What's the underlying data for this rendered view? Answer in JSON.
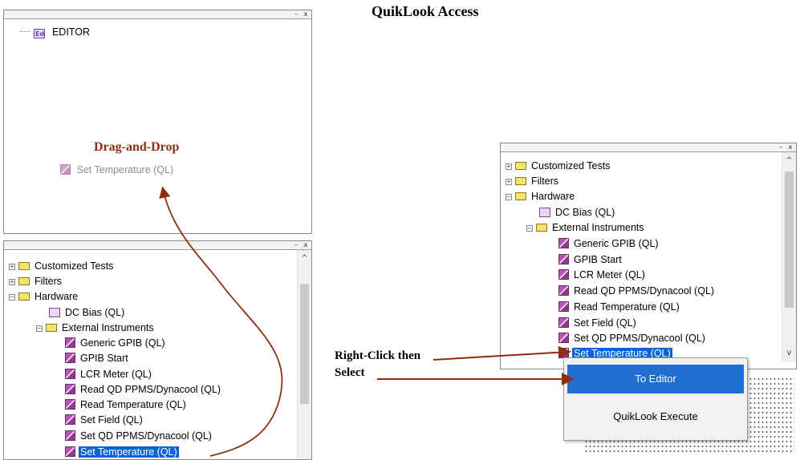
{
  "titles": {
    "main": "QuikLook Access",
    "drag_drop": "Drag-and-Drop"
  },
  "window_controls": {
    "min": "–",
    "close": "x"
  },
  "editor": {
    "root_label": "EDITOR",
    "root_icon": "editor-icon",
    "ghost_item": "Set Temperature (QL)"
  },
  "tree": {
    "customized": "Customized Tests",
    "filters": "Filters",
    "hardware": "Hardware",
    "dc_bias": "DC Bias (QL)",
    "external": "External Instruments",
    "generic_gpib": "Generic GPIB (QL)",
    "gpib_start": "GPIB Start",
    "lcr": "LCR Meter (QL)",
    "read_qd": "Read QD PPMS/Dynacool (QL)",
    "read_temp": "Read Temperature (QL)",
    "set_field": "Set Field (QL)",
    "set_qd": "Set QD PPMS/Dynacool (QL)",
    "set_temp": "Set Temperature (QL)",
    "expand": "+",
    "collapse": "–"
  },
  "scrollbar": {
    "up": "^",
    "down": "v"
  },
  "annotations": {
    "right_click": "Right-Click then",
    "select": "Select"
  },
  "context_menu": {
    "to_editor": "To Editor",
    "quiklook_execute": "QuikLook Execute"
  },
  "colors": {
    "accent": "#8b2f0f",
    "selection": "#0a64d8",
    "menu_highlight": "#1e6fd0",
    "folder": "#f7e26a"
  }
}
